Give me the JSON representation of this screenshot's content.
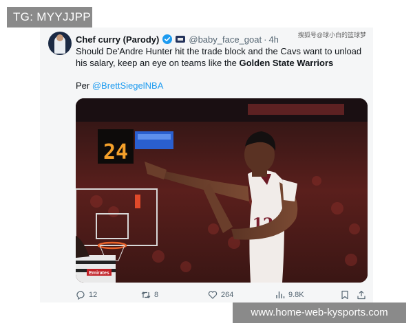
{
  "overlay": {
    "badge": "TG: MYYJJPP",
    "site": "www.home-web-kysports.com"
  },
  "tweet": {
    "author_name": "Chef curry (Parody)",
    "handle": "@baby_face_goat",
    "separator": "·",
    "time": "4h",
    "watermark": "搜狐号@球小白的篮球梦",
    "text_before": "Should De'Andre Hunter hit the trade block and the Cavs want to unload his salary, keep an eye on teams like the ",
    "text_bold": "Golden State Warriors",
    "credit_prefix": "Per ",
    "credit_handle": "@BrettSiegelNBA",
    "photo": {
      "scoreboard_text": "24",
      "jersey_number": "12",
      "sponsor_text": "Emirates"
    }
  },
  "actions": {
    "replies": "12",
    "reposts": "8",
    "likes": "264",
    "views": "9.8K"
  },
  "icons": {
    "verified": "verified-badge-icon",
    "flag": "flag-icon",
    "reply": "reply-icon",
    "repost": "repost-icon",
    "like": "heart-icon",
    "views": "views-chart-icon",
    "bookmark": "bookmark-icon",
    "share": "share-icon"
  },
  "colors": {
    "link": "#1d9bf0",
    "verified": "#1d9bf0",
    "card_bg": "#f5f6f7",
    "overlay_gray": "#8a8a8a"
  }
}
